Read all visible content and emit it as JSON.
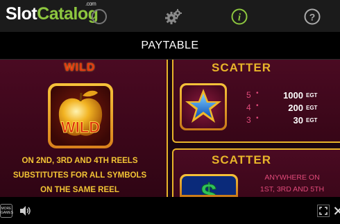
{
  "brand": {
    "name_part1": "Slot",
    "name_part2": "Catalog",
    "tld": ".com"
  },
  "nav": {
    "icons": [
      "slot-machine-icon",
      "gear-icon",
      "info-icon",
      "help-icon"
    ],
    "active": "info-icon",
    "active_color": "#8dc63f"
  },
  "header": {
    "title": "PAYTABLE"
  },
  "wild": {
    "title": "WILD",
    "symbol_label": "WILD",
    "description": [
      "ON 2ND, 3RD AND 4TH REELS",
      "SUBSTITUTES FOR ALL SYMBOLS",
      "ON THE SAME REEL"
    ]
  },
  "scatter_star": {
    "title": "SCATTER",
    "pays": [
      {
        "count": "5",
        "value": "1000",
        "unit": "EGT"
      },
      {
        "count": "4",
        "value": "200",
        "unit": "EGT"
      },
      {
        "count": "3",
        "value": "30",
        "unit": "EGT"
      }
    ]
  },
  "scatter_dollar": {
    "title": "SCATTER",
    "note": [
      "ANYWHERE ON",
      "1ST, 3RD AND 5TH"
    ]
  },
  "bottom": {
    "more_games_label": "MORE GAMES"
  },
  "colors": {
    "gold": "#e8b52a",
    "wild_red": "#e8360f",
    "pink": "#e04a7a",
    "panel": "#4a0a22"
  }
}
